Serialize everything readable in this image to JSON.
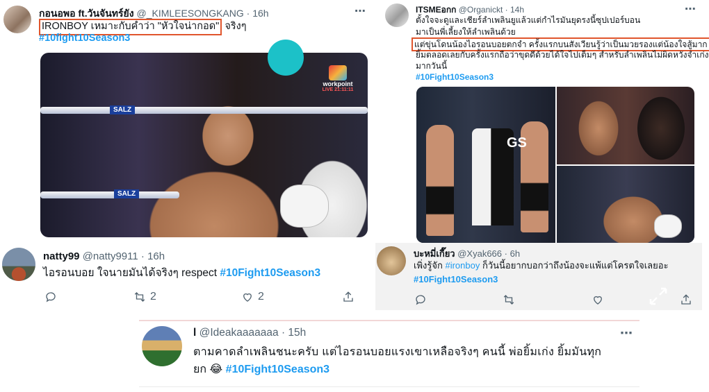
{
  "tweets": [
    {
      "name": "กอนอพอ ft.วันจันทร์ยัง",
      "handle": "@_KIMLEESONGKANG",
      "time": "16h",
      "highlight": "IRONBOY เหมาะกับคำว่า \"หัวใจน่ากอด\"",
      "after_highlight": "จริงๆ",
      "hashtag": "#10fight10Season3",
      "media": {
        "ring_label_1": "SALZ",
        "ring_label_2": "SALZ",
        "badge": "workpoint",
        "badge_sub": "LIVE 21:11:11"
      }
    },
    {
      "name": "natty99",
      "handle": "@natty9911",
      "time": "16h",
      "text": "ไอรอนบอย ใจนายมันได้จริงๆ respect",
      "hashtag": "#10Fight10Season3",
      "retweets": "2",
      "likes": "2"
    },
    {
      "name": "ITSMEอกก ",
      "handle": "@Organickt",
      "time": "14h",
      "line1": "ตั้งใจจะดูและเชียร์ลำเพลินยูแล้วแต่กำไรมันยุดรงนี้ซุปเปอร์บอน",
      "line2": "มาเป็นพี่เลี้ยงให้ลำเพลินด้วย",
      "line3_highlight": "แต่ขุ่นโดนน้องไอรอนบอยตกจำ ครั้งแรกบนสังเวียนรู้ว่าเป็นมวยรองแต่น้องใจสู้มาก",
      "line4": "ยิ้มตลอดเลยกับครั้งแรกถือว่าขุดดีด้วยได้ใจไปเต็มๆ สำหรับลำเพลินไม่ผิดหวังจำเก่ง",
      "line5": "มากวันนี้",
      "hashtag": "#10Fight10Season3",
      "media": {
        "gs_label": "GS"
      }
    },
    {
      "name": "บะหมี่เกี๊ยว",
      "handle": "@Xyak666",
      "time": "6h",
      "line1_pre": "เพิ่งรู้จัก",
      "line1_tag": "#ironboy",
      "line1_post": "ก็วันนี้อยากบอกว่าถึงน้องจะแพ้แต่โครตใจเลยอะ",
      "hashtag": "#10Fight10Season3"
    },
    {
      "name": "l",
      "handle": "@Ideakaaaaaaa",
      "time": "15h",
      "line1": "ตามคาดลำเพลินชนะครับ แต่ไอรอนบอยแรงเขาเหลือจริงๆ คนนี้ พ่อยิ้มเก่ง ยิ้มมันทุก",
      "line2_pre": "ยก",
      "emoji": "😂",
      "hashtag": "#10Fight10Season3"
    }
  ],
  "icons": {
    "more": "⋯",
    "reply": "reply-icon",
    "retweet": "retweet-icon",
    "like": "heart-icon",
    "share": "share-icon",
    "expand": "expand-icon"
  },
  "colors": {
    "hashtag": "#1d9bf0",
    "highlight_box": "#e0552c",
    "meta": "#536471"
  }
}
